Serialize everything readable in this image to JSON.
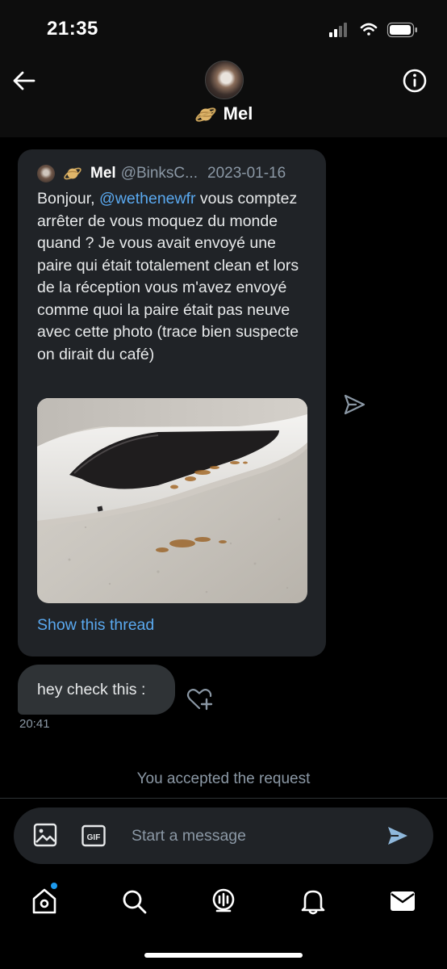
{
  "status_bar": {
    "time": "21:35",
    "icons": [
      "signal-icon",
      "wifi-icon",
      "battery-icon"
    ]
  },
  "header": {
    "name": "Mel",
    "emoji": "planet-icon"
  },
  "quoted_tweet": {
    "author": "Mel",
    "handle": "@BinksC...",
    "date": "2023-01-16",
    "text_before": "Bonjour, ",
    "mention": "@wethenewfr",
    "text_after": " vous comptez arrêter de vous moquez du monde quand ? Je vous avait envoyé une paire qui était totalement clean et lors de la réception vous m'avez envoyé comme quoi la paire était pas neuve avec cette photo (trace bien suspecte on dirait du café)",
    "show_thread": "Show this thread"
  },
  "message": {
    "text": "hey check this :",
    "time": "20:41"
  },
  "system_message": "You accepted the request",
  "composer": {
    "placeholder": "Start a message"
  },
  "nav": {
    "items": [
      "home-icon",
      "search-icon",
      "spaces-icon",
      "notifications-icon",
      "messages-icon"
    ]
  },
  "colors": {
    "accent": "#1d9bf0",
    "link": "#5aa9f0",
    "background": "#000000",
    "card": "#202327"
  }
}
